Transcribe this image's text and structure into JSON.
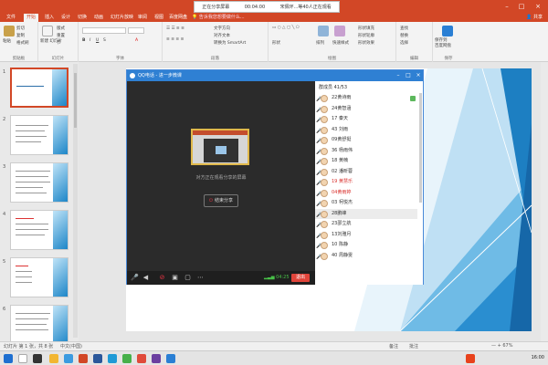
{
  "app": {
    "share_bar": {
      "status": "正在分享屏幕",
      "timer": "00:04:00",
      "note": "宋佩环...等40人正在观看"
    },
    "tabs": [
      "文件",
      "开始",
      "插入",
      "设计",
      "切换",
      "动画",
      "幻灯片放映",
      "审阅",
      "视图",
      "百度网盘"
    ],
    "active_tab": "开始",
    "tell_me": "告诉我您想要做什么...",
    "share_label": "共享",
    "colors": {
      "accent": "#d24726",
      "qq_blue": "#2f80d3",
      "exit_red": "#e0443a"
    }
  },
  "ribbon": {
    "clipboard": {
      "paste": "粘贴",
      "cut": "剪切",
      "copy": "复制",
      "format_painter": "格式刷",
      "group": "剪贴板"
    },
    "slides": {
      "new_slide": "新建\n幻灯片",
      "layout": "版式",
      "reset": "重置",
      "section": "节",
      "group": "幻灯片"
    },
    "font": {
      "group": "字体"
    },
    "paragraph": {
      "text_direction": "文字方向",
      "align_text": "对齐文本",
      "smartart": "转换为 SmartArt",
      "group": "段落"
    },
    "drawing": {
      "shapes": "形状",
      "arrange": "排列",
      "quick_styles": "快速样式",
      "fill": "形状填充",
      "outline": "形状轮廓",
      "effects": "形状效果",
      "group": "绘图"
    },
    "editing": {
      "find": "查找",
      "replace": "替换",
      "select": "选择",
      "group": "编辑"
    },
    "baidu": {
      "save": "保存到\n百度网盘",
      "group": "保存"
    }
  },
  "thumbnails": [
    {
      "num": "1"
    },
    {
      "num": "2"
    },
    {
      "num": "3"
    },
    {
      "num": "4"
    },
    {
      "num": "5"
    },
    {
      "num": "6"
    }
  ],
  "qq": {
    "title": "QQ电话 - 进一步微课",
    "sharing_text": "对方正在观看分享的屏幕",
    "end_share": "结束分享",
    "network_label": "",
    "signal": "04:25",
    "exit": "退出",
    "member_count": "群成员 41/53",
    "members": [
      {
        "name": "22黄诗雨",
        "red": false
      },
      {
        "name": "24黄智涵",
        "red": false
      },
      {
        "name": "17 秦天",
        "red": false
      },
      {
        "name": "43 刘雨",
        "red": false
      },
      {
        "name": "09黄舒挺",
        "red": false
      },
      {
        "name": "36 杨雨伟",
        "red": false
      },
      {
        "name": "18 黄楠",
        "red": false
      },
      {
        "name": "02 潘昕蓉",
        "red": false
      },
      {
        "name": "19 黄慧乐",
        "red": true
      },
      {
        "name": "04黄雨婷",
        "red": true
      },
      {
        "name": "03 柯悦杰",
        "red": false
      },
      {
        "name": "28鹏峰",
        "red": false
      },
      {
        "name": "23邵立航",
        "red": false
      },
      {
        "name": "13刘雅月",
        "red": false
      },
      {
        "name": "10 陈静",
        "red": false
      },
      {
        "name": "40 周静雯",
        "red": false
      }
    ]
  },
  "status": {
    "slide_info": "幻灯片 第 1 张，共 8 张",
    "language": "中文(中国)",
    "notes": "备注",
    "comments": "批注",
    "zoom": "— + 67%"
  },
  "taskbar": {
    "time": "16:00"
  }
}
